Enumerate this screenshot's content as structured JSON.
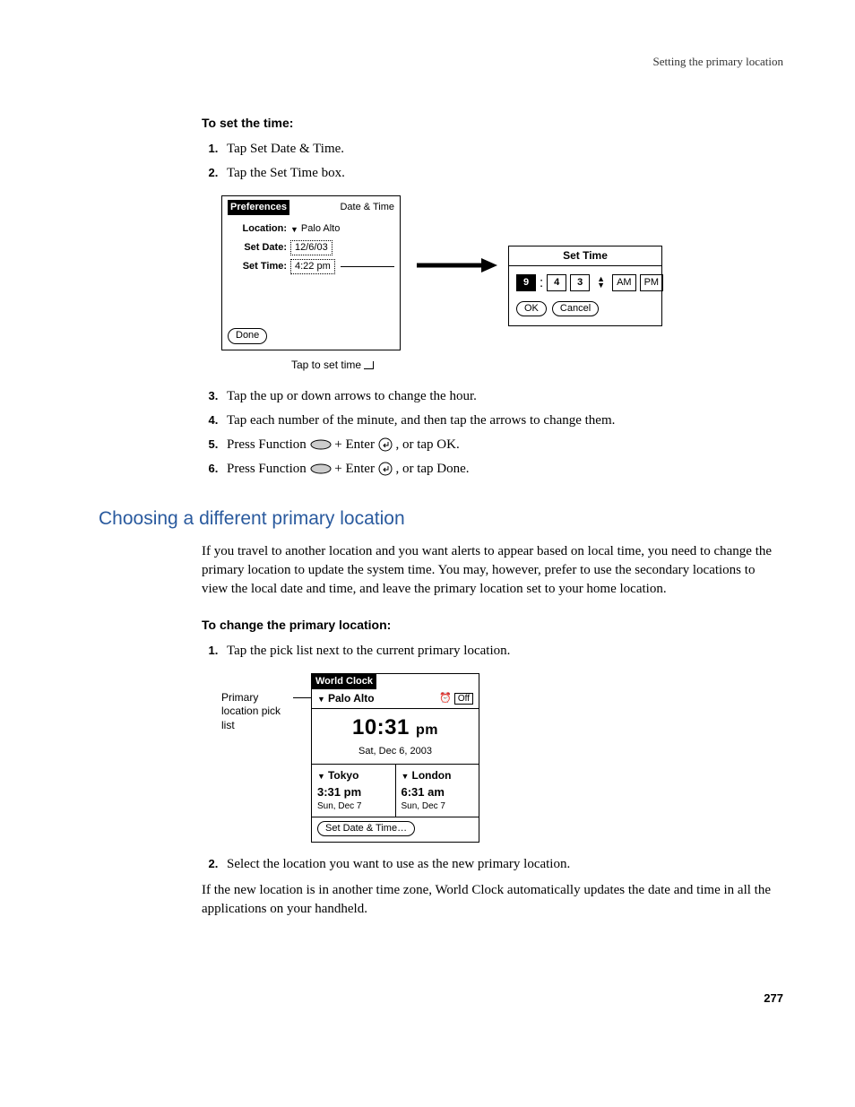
{
  "header": {
    "right": "Setting the primary location"
  },
  "section1": {
    "heading": "To set the time:",
    "steps_a": [
      "Tap Set Date & Time.",
      "Tap the Set Time box."
    ],
    "caption": "Tap to set time",
    "steps_b": [
      "Tap the up or down arrows to change the hour.",
      "Tap each number of the minute, and then tap the arrows to change them.",
      {
        "pre": "Press Function ",
        "post": " + Enter ",
        "tail": ", or tap OK."
      },
      {
        "pre": "Press Function ",
        "post": " + Enter ",
        "tail": ", or tap Done."
      }
    ]
  },
  "prefs": {
    "title": "Preferences",
    "cat": "Date & Time",
    "location_label": "Location:",
    "location_value": "Palo Alto",
    "setdate_label": "Set Date:",
    "setdate_value": "12/6/03",
    "settime_label": "Set Time:",
    "settime_value": "4:22 pm",
    "done": "Done"
  },
  "settime": {
    "title": "Set Time",
    "hour": "9",
    "min1": "4",
    "min2": "3",
    "am": "AM",
    "pm": "PM",
    "ok": "OK",
    "cancel": "Cancel"
  },
  "section2": {
    "title": "Choosing a different primary location",
    "para": "If you travel to another location and you want alerts to appear based on local time, you need to change the primary location to update the system time. You may, however, prefer to use the secondary locations to view the local date and time, and leave the primary location set to your home location.",
    "heading": "To change the primary location:",
    "step1": "Tap the pick list next to the current primary location.",
    "label": "Primary location pick list",
    "step2": "Select the location you want to use as the new primary location.",
    "para2": "If the new location is in another time zone, World Clock automatically updates the date and time in all the applications on your handheld."
  },
  "wc": {
    "title": "World Clock",
    "primary": "Palo Alto",
    "off": "Off",
    "time": "10:31",
    "ampm": "pm",
    "date": "Sat, Dec 6, 2003",
    "city1": "Tokyo",
    "time1": "3:31 pm",
    "date1": "Sun, Dec 7",
    "city2": "London",
    "time2": "6:31 am",
    "date2": "Sun, Dec 7",
    "setbtn": "Set Date & Time…"
  },
  "pagenum": "277"
}
